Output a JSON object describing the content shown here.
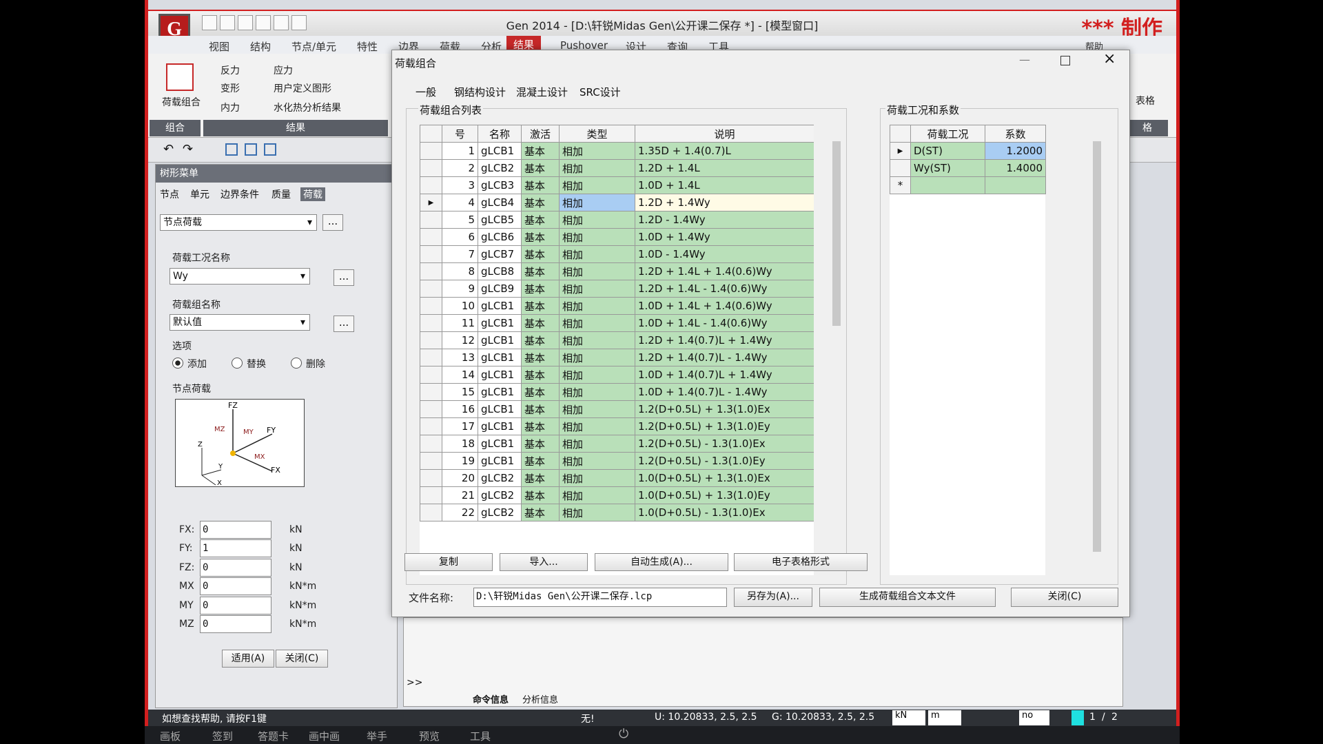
{
  "app": {
    "title": "Gen 2014 - [D:\\轩锐Midas Gen\\公开课二保存 *] - [模型窗口]",
    "logo": "G",
    "watermark": "*** 制作",
    "help": "帮助"
  },
  "menu": [
    "视图",
    "结构",
    "节点/单元",
    "特性",
    "边界",
    "荷载",
    "分析",
    "结果",
    "Pushover",
    "设计",
    "查询",
    "工具"
  ],
  "menu_active": "结果",
  "ribbon": {
    "big_button": "荷载组合",
    "items": [
      "反力",
      "应力",
      "变形",
      "用户定义图形",
      "内力",
      "水化热分析结果"
    ],
    "group_combo": "组合",
    "group_result": "结果",
    "right_label": "表格",
    "right_group": "格"
  },
  "tree": {
    "title": "树形菜单",
    "tabs": [
      "节点",
      "单元",
      "边界条件",
      "质量",
      "荷载"
    ],
    "active_tab": "荷载",
    "load_type": "节点荷载",
    "lc_label": "荷载工况名称",
    "lc_value": "Wy",
    "lg_label": "荷载组名称",
    "lg_value": "默认值",
    "options_label": "选项",
    "opt_add": "添加",
    "opt_replace": "替换",
    "opt_delete": "删除",
    "diagram_label": "节点荷载",
    "fields": [
      {
        "name": "FX:",
        "value": "0",
        "unit": "kN"
      },
      {
        "name": "FY:",
        "value": "1",
        "unit": "kN"
      },
      {
        "name": "FZ:",
        "value": "0",
        "unit": "kN"
      },
      {
        "name": "MX",
        "value": "0",
        "unit": "kN*m"
      },
      {
        "name": "MY",
        "value": "0",
        "unit": "kN*m"
      },
      {
        "name": "MZ",
        "value": "0",
        "unit": "kN*m"
      }
    ],
    "apply": "适用(A)",
    "close": "关闭(C)"
  },
  "dialog": {
    "title": "荷载组合",
    "tabs": [
      "一般",
      "钢结构设计",
      "混凝土设计",
      "SRC设计"
    ],
    "list_title": "荷载组合列表",
    "cols": [
      "号",
      "名称",
      "激活",
      "类型",
      "说明"
    ],
    "rows": [
      [
        "1",
        "gLCB1",
        "基本",
        "相加",
        "1.35D + 1.4(0.7)L"
      ],
      [
        "2",
        "gLCB2",
        "基本",
        "相加",
        "1.2D + 1.4L"
      ],
      [
        "3",
        "gLCB3",
        "基本",
        "相加",
        "1.0D + 1.4L"
      ],
      [
        "4",
        "gLCB4",
        "基本",
        "相加",
        "1.2D + 1.4Wy"
      ],
      [
        "5",
        "gLCB5",
        "基本",
        "相加",
        "1.2D - 1.4Wy"
      ],
      [
        "6",
        "gLCB6",
        "基本",
        "相加",
        "1.0D + 1.4Wy"
      ],
      [
        "7",
        "gLCB7",
        "基本",
        "相加",
        "1.0D - 1.4Wy"
      ],
      [
        "8",
        "gLCB8",
        "基本",
        "相加",
        "1.2D + 1.4L + 1.4(0.6)Wy"
      ],
      [
        "9",
        "gLCB9",
        "基本",
        "相加",
        "1.2D + 1.4L - 1.4(0.6)Wy"
      ],
      [
        "10",
        "gLCB1",
        "基本",
        "相加",
        "1.0D + 1.4L + 1.4(0.6)Wy"
      ],
      [
        "11",
        "gLCB1",
        "基本",
        "相加",
        "1.0D + 1.4L - 1.4(0.6)Wy"
      ],
      [
        "12",
        "gLCB1",
        "基本",
        "相加",
        "1.2D + 1.4(0.7)L + 1.4Wy"
      ],
      [
        "13",
        "gLCB1",
        "基本",
        "相加",
        "1.2D + 1.4(0.7)L - 1.4Wy"
      ],
      [
        "14",
        "gLCB1",
        "基本",
        "相加",
        "1.0D + 1.4(0.7)L + 1.4Wy"
      ],
      [
        "15",
        "gLCB1",
        "基本",
        "相加",
        "1.0D + 1.4(0.7)L - 1.4Wy"
      ],
      [
        "16",
        "gLCB1",
        "基本",
        "相加",
        "1.2(D+0.5L) + 1.3(1.0)Ex"
      ],
      [
        "17",
        "gLCB1",
        "基本",
        "相加",
        "1.2(D+0.5L) + 1.3(1.0)Ey"
      ],
      [
        "18",
        "gLCB1",
        "基本",
        "相加",
        "1.2(D+0.5L) - 1.3(1.0)Ex"
      ],
      [
        "19",
        "gLCB1",
        "基本",
        "相加",
        "1.2(D+0.5L) - 1.3(1.0)Ey"
      ],
      [
        "20",
        "gLCB2",
        "基本",
        "相加",
        "1.0(D+0.5L) + 1.3(1.0)Ex"
      ],
      [
        "21",
        "gLCB2",
        "基本",
        "相加",
        "1.0(D+0.5L) + 1.3(1.0)Ey"
      ],
      [
        "22",
        "gLCB2",
        "基本",
        "相加",
        "1.0(D+0.5L) - 1.3(1.0)Ex"
      ]
    ],
    "selected_row": 3,
    "case_title": "荷载工况和系数",
    "case_cols": [
      "荷载工况",
      "系数"
    ],
    "case_rows": [
      [
        "D(ST)",
        "1.2000"
      ],
      [
        "Wy(ST)",
        "1.4000"
      ]
    ],
    "buttons": [
      "复制",
      "导入...",
      "自动生成(A)...",
      "电子表格形式"
    ],
    "file_label": "文件名称:",
    "file_value": "D:\\轩锐Midas Gen\\公开课二保存.lcp",
    "save_as": "另存为(A)...",
    "gen_text": "生成荷载组合文本文件",
    "close": "关闭(C)"
  },
  "command": {
    "prompt": ">>",
    "tab1": "命令信息",
    "tab2": "分析信息"
  },
  "status": {
    "help": "如想查找帮助, 请按F1键",
    "none": "无!",
    "u": "U: 10.20833, 2.5, 2.5",
    "g": "G: 10.20833, 2.5, 2.5",
    "unit_force": "kN",
    "unit_len": "m",
    "no": "no",
    "page": "1",
    "pages": "2"
  },
  "taskbar": [
    "画板",
    "签到",
    "答题卡",
    "画中画",
    "举手",
    "预览",
    "工具"
  ],
  "colors": {
    "accent": "#d21f1f",
    "grid_green": "#b9e0b9",
    "selected": "#a9cdf3"
  }
}
